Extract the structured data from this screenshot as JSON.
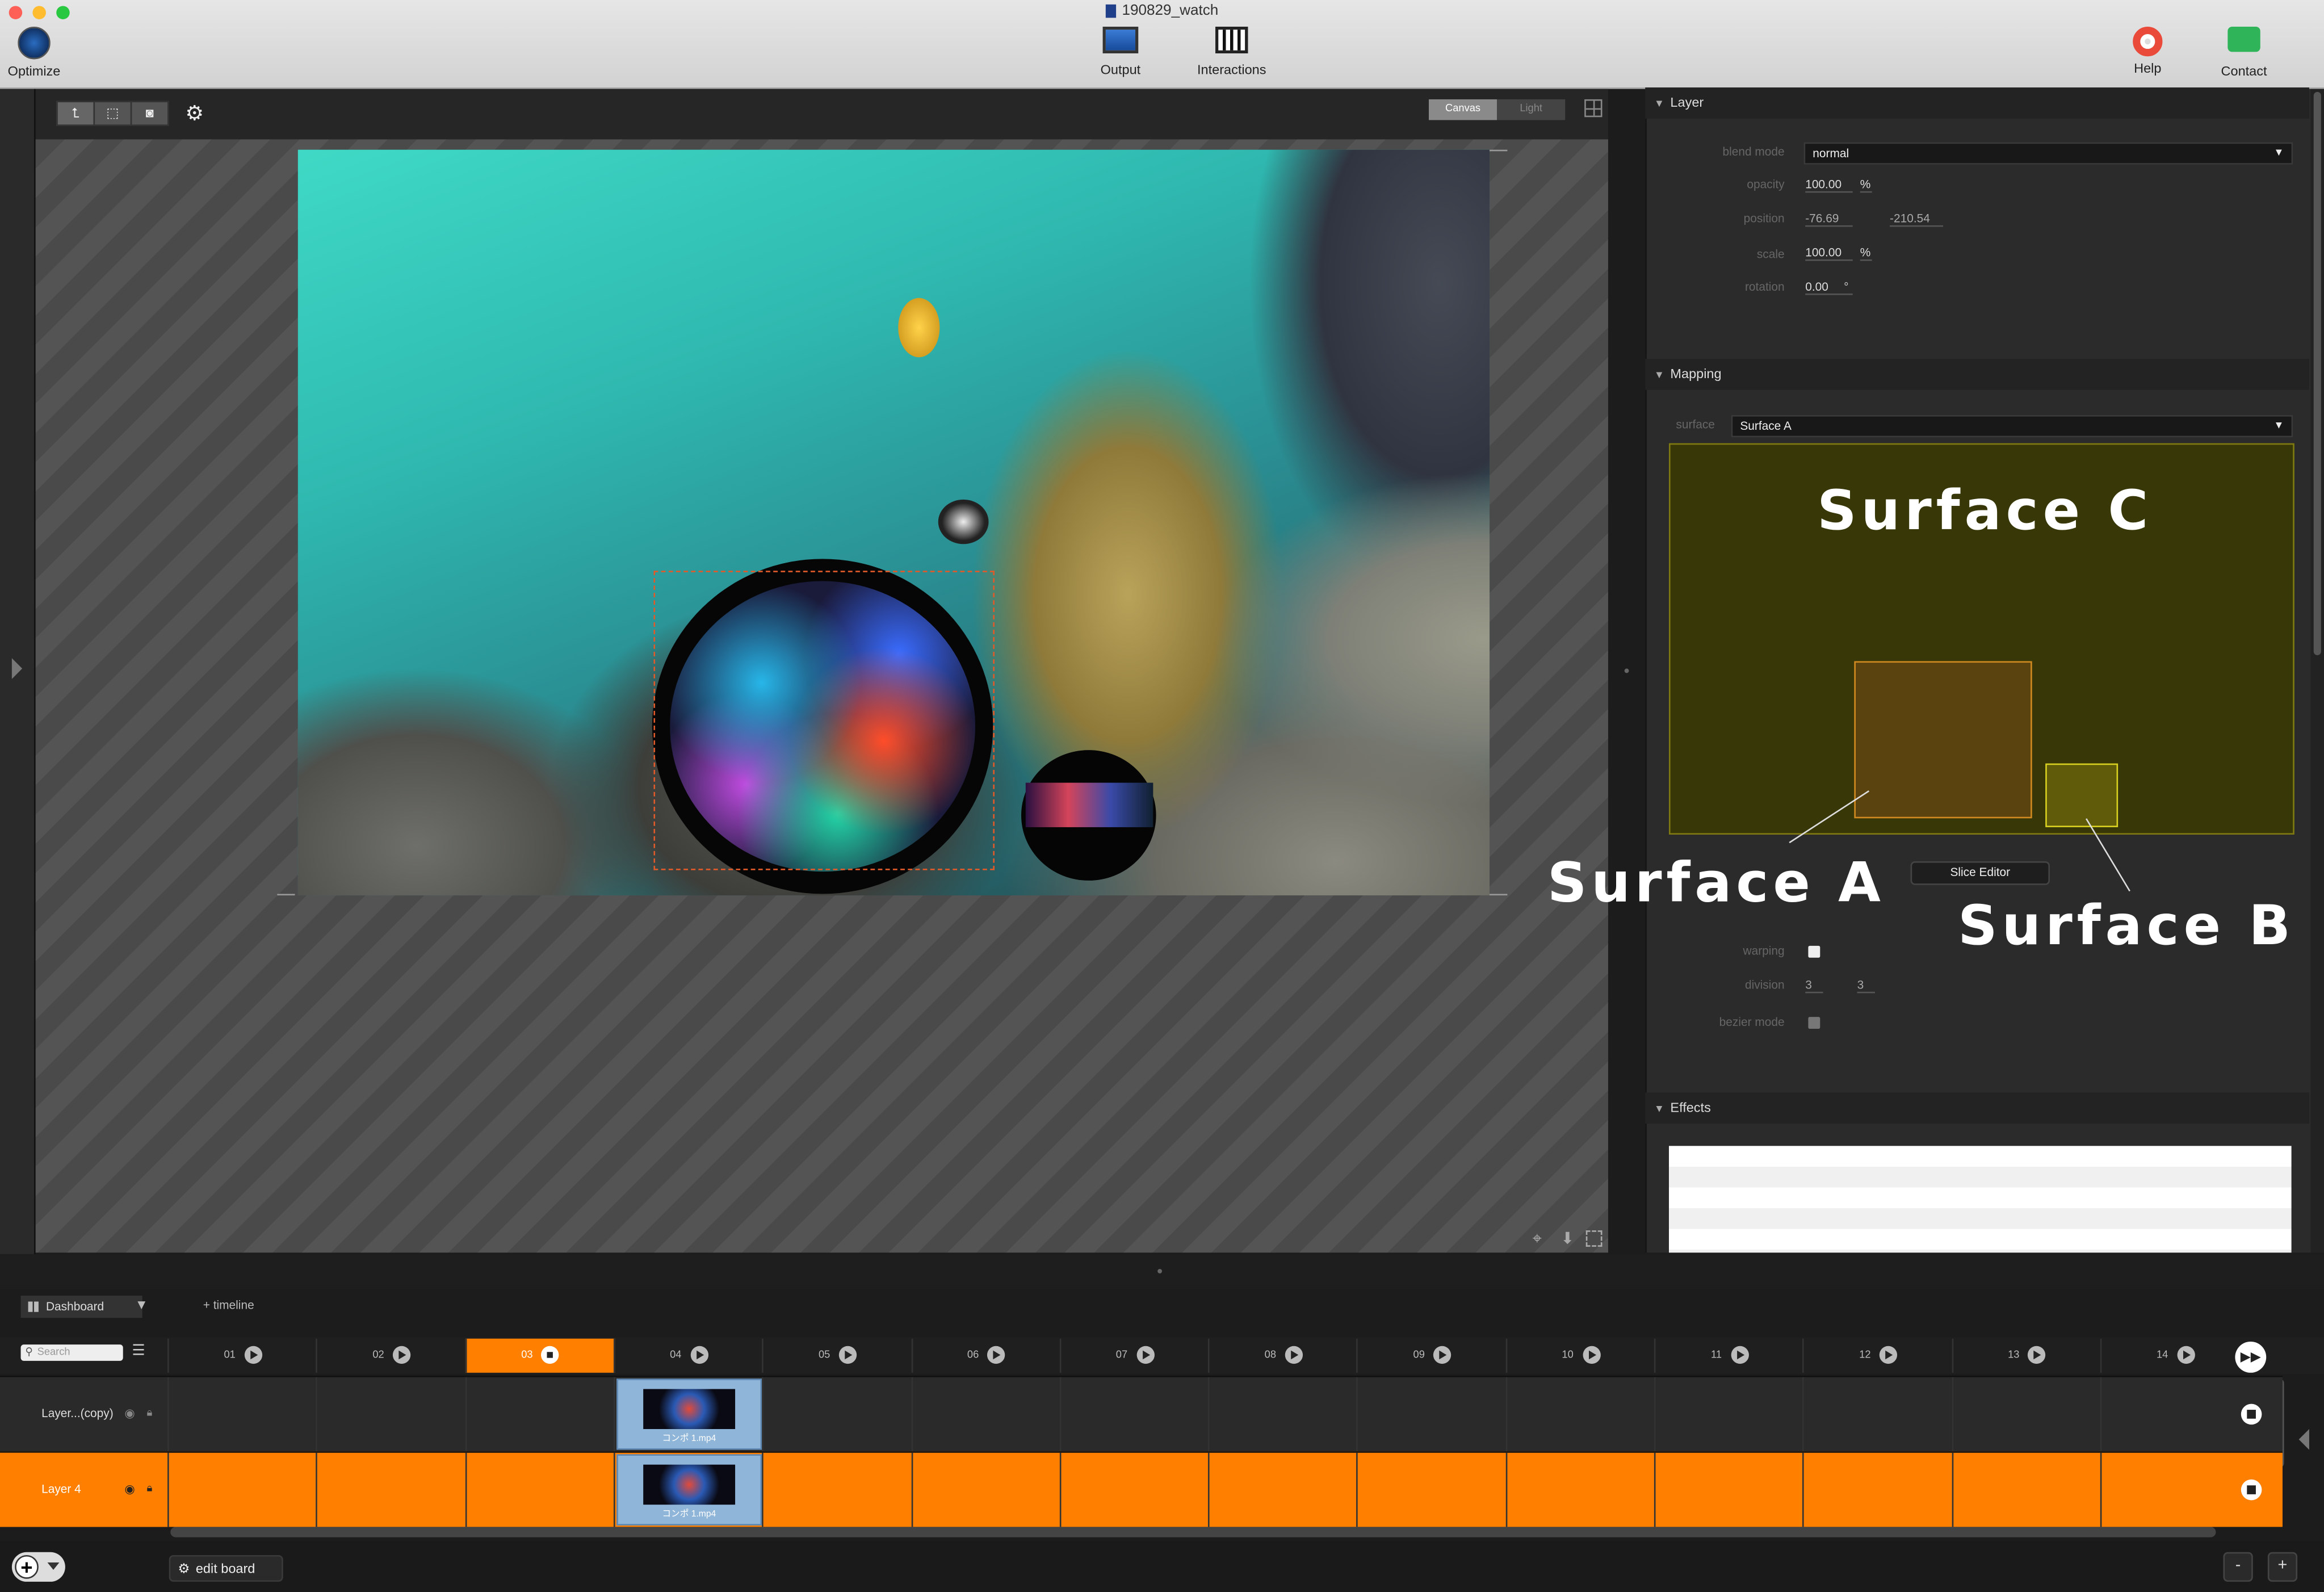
{
  "window": {
    "title": "190829_watch",
    "toolbar": {
      "optimize": "Optimize",
      "output": "Output",
      "interactions": "Interactions",
      "help": "Help",
      "contact": "Contact"
    }
  },
  "canvas_toolbar": {
    "view_canvas": "Canvas",
    "view_light": "Light"
  },
  "layer_panel": {
    "title": "Layer",
    "blend_mode_label": "blend mode",
    "blend_mode": "normal",
    "opacity_label": "opacity",
    "opacity": "100.00",
    "opacity_unit": "%",
    "position_label": "position",
    "position_x": "-76.69",
    "position_y": "-210.54",
    "scale_label": "scale",
    "scale": "100.00",
    "scale_unit": "%",
    "rotation_label": "rotation",
    "rotation": "0.00",
    "rotation_unit": "°"
  },
  "mapping_panel": {
    "title": "Mapping",
    "surface_label": "surface",
    "surface": "Surface A",
    "slice_editor": "Slice Editor",
    "warping_label": "warping",
    "division_label": "division",
    "division_x": "3",
    "division_y": "3",
    "bezier_label": "bezier mode"
  },
  "annotations": {
    "surface_c": "Surface C",
    "surface_a": "Surface A",
    "surface_b": "Surface B"
  },
  "effects_panel": {
    "title": "Effects"
  },
  "dashboard": {
    "tab": "Dashboard",
    "timeline_link": "+ timeline",
    "search_placeholder": "Search",
    "columns": [
      "01",
      "02",
      "03",
      "04",
      "05",
      "06",
      "07",
      "08",
      "09",
      "10",
      "11",
      "12",
      "13",
      "14"
    ],
    "active_column": "03",
    "rows": [
      {
        "label": "Layer...(copy)",
        "clip": "コンポ 1.mp4"
      },
      {
        "label": "Layer 4",
        "clip": "コンポ 1.mp4"
      }
    ],
    "edit_board": "edit board"
  },
  "colors": {
    "accent_orange": "#ff8000",
    "clip_blue": "#8fb5d9",
    "mapping_bg": "#383708"
  }
}
